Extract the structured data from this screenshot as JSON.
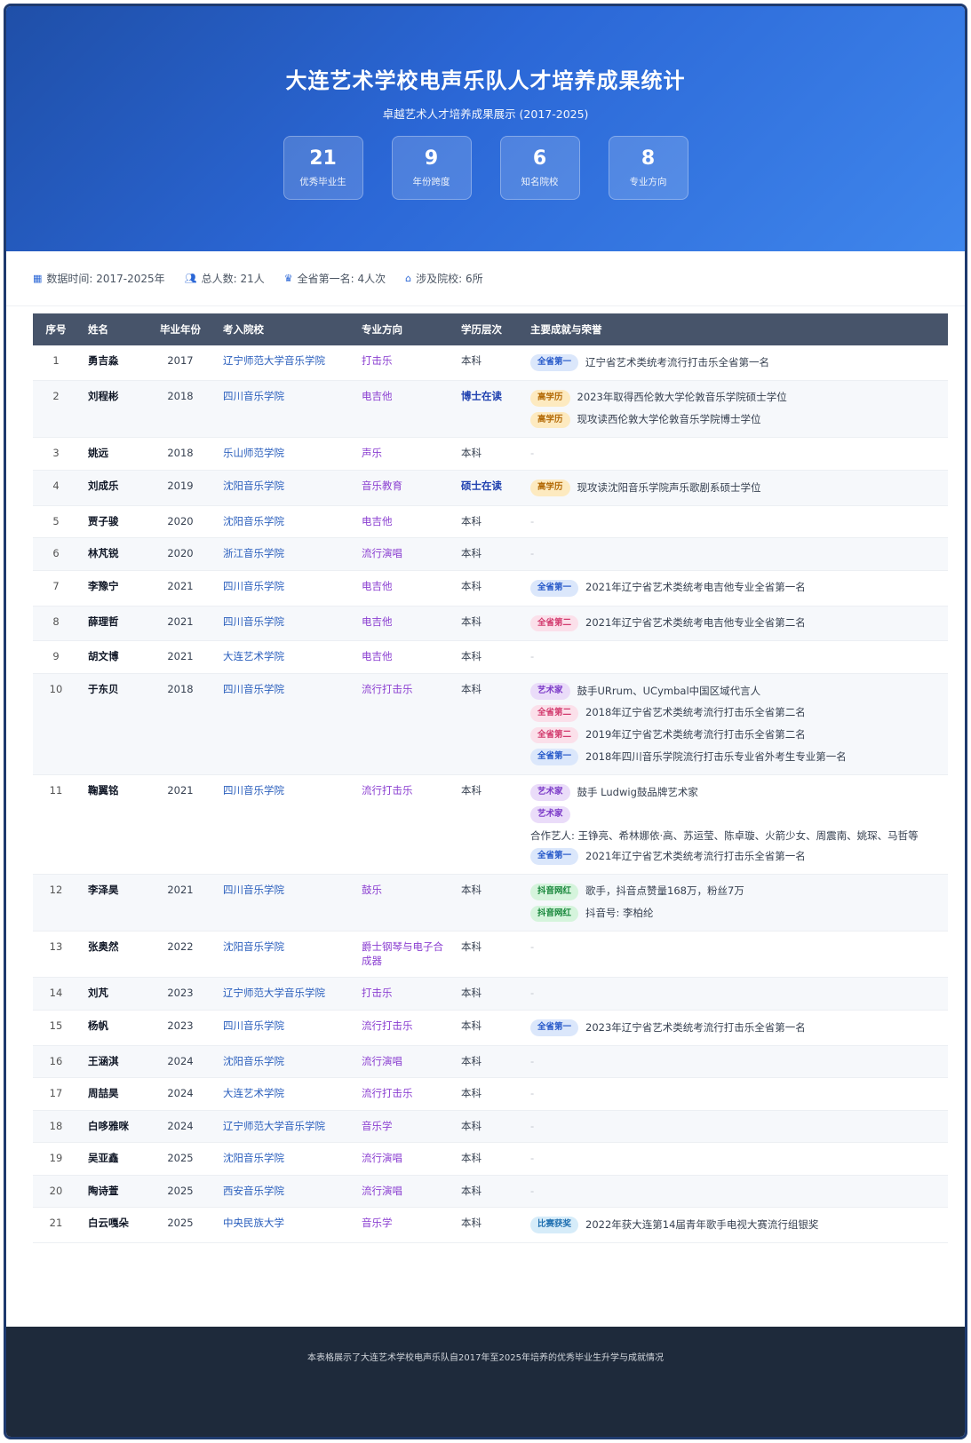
{
  "header": {
    "title": "大连艺术学校电声乐队人才培养成果统计",
    "subtitle": "卓越艺术人才培养成果展示 (2017-2025)",
    "stats": [
      {
        "num": "21",
        "label": "优秀毕业生"
      },
      {
        "num": "9",
        "label": "年份跨度"
      },
      {
        "num": "6",
        "label": "知名院校"
      },
      {
        "num": "8",
        "label": "专业方向"
      }
    ]
  },
  "info": {
    "data_time": "数据时间: 2017-2025年",
    "total": "总人数: 21人",
    "first": "全省第一名: 4人次",
    "schools": "涉及院校: 6所"
  },
  "table": {
    "headers": [
      "序号",
      "姓名",
      "毕业年份",
      "考入院校",
      "专业方向",
      "学历层次",
      "主要成就与荣誉"
    ],
    "rows": [
      {
        "idx": "1",
        "name": "勇吉淼",
        "year": "2017",
        "school": "辽宁师范大学音乐学院",
        "major": "打击乐",
        "degree": "本科",
        "hi": false,
        "ach": [
          {
            "badge": "全省第一",
            "color": "blue",
            "text": "辽宁省艺术类统考流行打击乐全省第一名"
          }
        ]
      },
      {
        "idx": "2",
        "name": "刘程彬",
        "year": "2018",
        "school": "四川音乐学院",
        "major": "电吉他",
        "degree": "博士在读",
        "hi": true,
        "ach": [
          {
            "badge": "高学历",
            "color": "yellow",
            "text": "2023年取得西伦敦大学伦敦音乐学院硕士学位"
          },
          {
            "badge": "高学历",
            "color": "yellow",
            "text": "现攻读西伦敦大学伦敦音乐学院博士学位"
          }
        ]
      },
      {
        "idx": "3",
        "name": "姚远",
        "year": "2018",
        "school": "乐山师范学院",
        "major": "声乐",
        "degree": "本科",
        "hi": false,
        "ach": []
      },
      {
        "idx": "4",
        "name": "刘成乐",
        "year": "2019",
        "school": "沈阳音乐学院",
        "major": "音乐教育",
        "degree": "硕士在读",
        "hi": true,
        "ach": [
          {
            "badge": "高学历",
            "color": "yellow",
            "text": "现攻读沈阳音乐学院声乐歌剧系硕士学位"
          }
        ]
      },
      {
        "idx": "5",
        "name": "贾子骏",
        "year": "2020",
        "school": "沈阳音乐学院",
        "major": "电吉他",
        "degree": "本科",
        "hi": false,
        "ach": []
      },
      {
        "idx": "6",
        "name": "林芃锐",
        "year": "2020",
        "school": "浙江音乐学院",
        "major": "流行演唱",
        "degree": "本科",
        "hi": false,
        "ach": []
      },
      {
        "idx": "7",
        "name": "李豫宁",
        "year": "2021",
        "school": "四川音乐学院",
        "major": "电吉他",
        "degree": "本科",
        "hi": false,
        "ach": [
          {
            "badge": "全省第一",
            "color": "blue",
            "text": "2021年辽宁省艺术类统考电吉他专业全省第一名"
          }
        ]
      },
      {
        "idx": "8",
        "name": "薛理哲",
        "year": "2021",
        "school": "四川音乐学院",
        "major": "电吉他",
        "degree": "本科",
        "hi": false,
        "ach": [
          {
            "badge": "全省第二",
            "color": "pink",
            "text": "2021年辽宁省艺术类统考电吉他专业全省第二名"
          }
        ]
      },
      {
        "idx": "9",
        "name": "胡文博",
        "year": "2021",
        "school": "大连艺术学院",
        "major": "电吉他",
        "degree": "本科",
        "hi": false,
        "ach": []
      },
      {
        "idx": "10",
        "name": "于东贝",
        "year": "2018",
        "school": "四川音乐学院",
        "major": "流行打击乐",
        "degree": "本科",
        "hi": false,
        "ach": [
          {
            "badge": "艺术家",
            "color": "purple",
            "text": "鼓手URrum、UCymbal中国区域代言人"
          },
          {
            "badge": "全省第二",
            "color": "pink",
            "text": "2018年辽宁省艺术类统考流行打击乐全省第二名"
          },
          {
            "badge": "全省第二",
            "color": "pink",
            "text": "2019年辽宁省艺术类统考流行打击乐全省第二名"
          },
          {
            "badge": "全省第一",
            "color": "blue",
            "text": "2018年四川音乐学院流行打击乐专业省外考生专业第一名"
          }
        ]
      },
      {
        "idx": "11",
        "name": "鞠翼铭",
        "year": "2021",
        "school": "四川音乐学院",
        "major": "流行打击乐",
        "degree": "本科",
        "hi": false,
        "ach": [
          {
            "badge": "艺术家",
            "color": "purple",
            "text": "鼓手 Ludwig鼓品牌艺术家"
          },
          {
            "badge": "艺术家",
            "color": "purple",
            "text": ""
          },
          {
            "badge": "",
            "color": "",
            "text": "合作艺人: 王铮亮、希林娜依·高、苏运莹、陈卓璇、火箭少女、周震南、姚琛、马哲等"
          },
          {
            "badge": "全省第一",
            "color": "blue",
            "text": "2021年辽宁省艺术类统考流行打击乐全省第一名"
          }
        ]
      },
      {
        "idx": "12",
        "name": "李泽昊",
        "year": "2021",
        "school": "四川音乐学院",
        "major": "鼓乐",
        "degree": "本科",
        "hi": false,
        "ach": [
          {
            "badge": "抖音网红",
            "color": "green",
            "text": "歌手，抖音点赞量168万，粉丝7万"
          },
          {
            "badge": "抖音网红",
            "color": "green",
            "text": "抖音号: 李柏纶"
          }
        ]
      },
      {
        "idx": "13",
        "name": "张奥然",
        "year": "2022",
        "school": "沈阳音乐学院",
        "major": "爵士钢琴与电子合成器",
        "degree": "本科",
        "hi": false,
        "ach": []
      },
      {
        "idx": "14",
        "name": "刘芃",
        "year": "2023",
        "school": "辽宁师范大学音乐学院",
        "major": "打击乐",
        "degree": "本科",
        "hi": false,
        "ach": []
      },
      {
        "idx": "15",
        "name": "杨帆",
        "year": "2023",
        "school": "四川音乐学院",
        "major": "流行打击乐",
        "degree": "本科",
        "hi": false,
        "ach": [
          {
            "badge": "全省第一",
            "color": "blue",
            "text": "2023年辽宁省艺术类统考流行打击乐全省第一名"
          }
        ]
      },
      {
        "idx": "16",
        "name": "王涵淇",
        "year": "2024",
        "school": "沈阳音乐学院",
        "major": "流行演唱",
        "degree": "本科",
        "hi": false,
        "ach": []
      },
      {
        "idx": "17",
        "name": "周喆昊",
        "year": "2024",
        "school": "大连艺术学院",
        "major": "流行打击乐",
        "degree": "本科",
        "hi": false,
        "ach": []
      },
      {
        "idx": "18",
        "name": "白哆雅咪",
        "year": "2024",
        "school": "辽宁师范大学音乐学院",
        "major": "音乐学",
        "degree": "本科",
        "hi": false,
        "ach": []
      },
      {
        "idx": "19",
        "name": "吴亚鑫",
        "year": "2025",
        "school": "沈阳音乐学院",
        "major": "流行演唱",
        "degree": "本科",
        "hi": false,
        "ach": []
      },
      {
        "idx": "20",
        "name": "陶诗萱",
        "year": "2025",
        "school": "西安音乐学院",
        "major": "流行演唱",
        "degree": "本科",
        "hi": false,
        "ach": []
      },
      {
        "idx": "21",
        "name": "白云嘎朵",
        "year": "2025",
        "school": "中央民族大学",
        "major": "音乐学",
        "degree": "本科",
        "hi": false,
        "ach": [
          {
            "badge": "比赛获奖",
            "color": "cyan",
            "text": "2022年获大连第14届青年歌手电视大赛流行组银奖"
          }
        ]
      }
    ],
    "empty_mark": "-"
  },
  "footer": {
    "text": "本表格展示了大连艺术学校电声乐队自2017年至2025年培养的优秀毕业生升学与成就情况"
  },
  "colors": {
    "header_start": "#1f4fa8",
    "header_end": "#3f86ec",
    "table_head": "#47546a",
    "footer_bg": "#1e2a3b"
  },
  "icons": [
    "graduation-cap-icon",
    "calendar-icon",
    "users-icon",
    "trophy-icon",
    "school-icon"
  ]
}
